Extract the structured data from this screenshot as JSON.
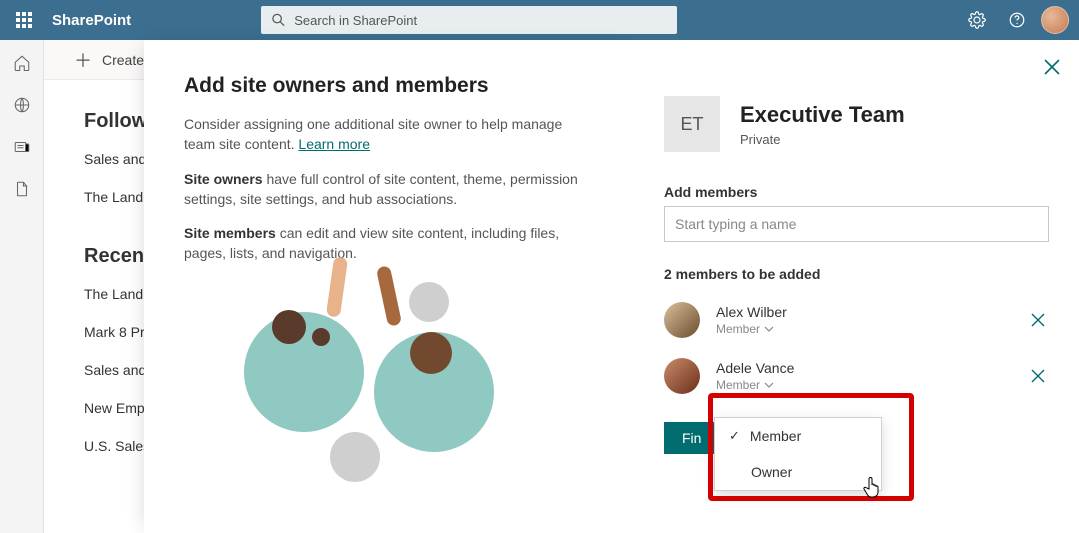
{
  "header": {
    "brand": "SharePoint",
    "search_placeholder": "Search in SharePoint"
  },
  "create_bar": {
    "label": "Create s"
  },
  "following": {
    "heading": "Followi",
    "items": [
      "Sales and",
      "The Landin"
    ]
  },
  "recent": {
    "heading": "Recent",
    "items": [
      "The Landin",
      "Mark 8 Pro",
      "Sales and",
      "New Empl",
      "U.S. Sales"
    ]
  },
  "info_panel": {
    "title": "Add site owners and members",
    "intro": "Consider assigning one additional site owner to help manage team site content. ",
    "learn_more": "Learn more",
    "owners_strong": "Site owners",
    "owners_rest": " have full control of site content, theme, permission settings, site settings, and hub associations.",
    "members_strong": "Site members",
    "members_rest": " can edit and view site content, including files, pages, lists, and navigation."
  },
  "members_panel": {
    "site_initials": "ET",
    "site_title": "Executive Team",
    "privacy": "Private",
    "add_label": "Add members",
    "name_placeholder": "Start typing a name",
    "to_be_added": "2 members to be added",
    "people": [
      {
        "name": "Alex Wilber",
        "role": "Member"
      },
      {
        "name": "Adele Vance",
        "role": "Member"
      }
    ],
    "finish_label": "Fin",
    "role_options": {
      "member": "Member",
      "owner": "Owner"
    }
  }
}
